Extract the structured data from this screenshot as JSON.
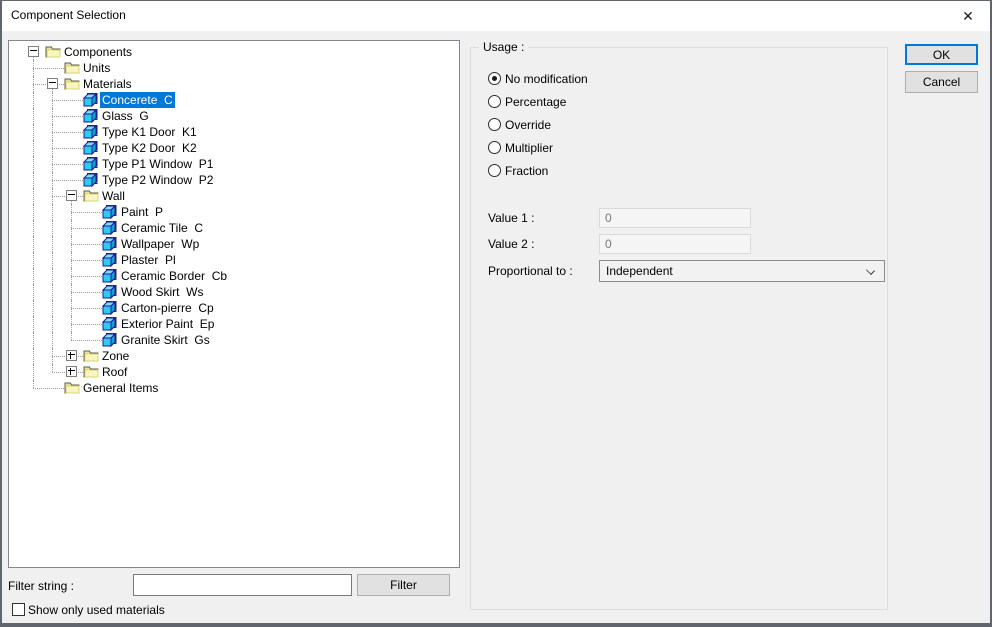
{
  "window": {
    "title": "Component Selection",
    "close_glyph": "✕"
  },
  "tree": {
    "items": [
      {
        "label": "Components",
        "depth": 0,
        "icon": "folder",
        "expander": "minus"
      },
      {
        "label": "Units",
        "depth": 1,
        "icon": "folder",
        "expander": "none"
      },
      {
        "label": "Materials",
        "depth": 1,
        "icon": "folder",
        "expander": "minus"
      },
      {
        "label": "Concerete  C",
        "depth": 2,
        "icon": "cube",
        "expander": "none",
        "selected": true
      },
      {
        "label": "Glass  G",
        "depth": 2,
        "icon": "cube",
        "expander": "none"
      },
      {
        "label": "Type K1 Door  K1",
        "depth": 2,
        "icon": "cube",
        "expander": "none"
      },
      {
        "label": "Type K2 Door  K2",
        "depth": 2,
        "icon": "cube",
        "expander": "none"
      },
      {
        "label": "Type P1 Window  P1",
        "depth": 2,
        "icon": "cube",
        "expander": "none"
      },
      {
        "label": "Type P2 Window  P2",
        "depth": 2,
        "icon": "cube",
        "expander": "none"
      },
      {
        "label": "Wall",
        "depth": 2,
        "icon": "folder",
        "expander": "minus"
      },
      {
        "label": "Paint  P",
        "depth": 3,
        "icon": "cube",
        "expander": "none"
      },
      {
        "label": "Ceramic Tile  C",
        "depth": 3,
        "icon": "cube",
        "expander": "none"
      },
      {
        "label": "Wallpaper  Wp",
        "depth": 3,
        "icon": "cube",
        "expander": "none"
      },
      {
        "label": "Plaster  Pl",
        "depth": 3,
        "icon": "cube",
        "expander": "none"
      },
      {
        "label": "Ceramic Border  Cb",
        "depth": 3,
        "icon": "cube",
        "expander": "none"
      },
      {
        "label": "Wood Skirt  Ws",
        "depth": 3,
        "icon": "cube",
        "expander": "none"
      },
      {
        "label": "Carton-pierre  Cp",
        "depth": 3,
        "icon": "cube",
        "expander": "none"
      },
      {
        "label": "Exterior Paint  Ep",
        "depth": 3,
        "icon": "cube",
        "expander": "none"
      },
      {
        "label": "Granite Skirt  Gs",
        "depth": 3,
        "icon": "cube",
        "expander": "none"
      },
      {
        "label": "Zone",
        "depth": 2,
        "icon": "folder",
        "expander": "plus"
      },
      {
        "label": "Roof",
        "depth": 2,
        "icon": "folder",
        "expander": "plus"
      },
      {
        "label": "General Items",
        "depth": 1,
        "icon": "folder",
        "expander": "none"
      }
    ]
  },
  "usage": {
    "label": "Usage :",
    "options": [
      {
        "label": "No modification",
        "selected": true
      },
      {
        "label": "Percentage",
        "selected": false
      },
      {
        "label": "Override",
        "selected": false
      },
      {
        "label": "Multiplier",
        "selected": false
      },
      {
        "label": "Fraction",
        "selected": false
      }
    ]
  },
  "fields": {
    "value1": {
      "label": "Value 1 :",
      "value": "0",
      "enabled": false
    },
    "value2": {
      "label": "Value 2 :",
      "value": "0",
      "enabled": false
    },
    "proportional": {
      "label": "Proportional to :",
      "value": "Independent"
    }
  },
  "buttons": {
    "ok": "OK",
    "cancel": "Cancel",
    "filter": "Filter"
  },
  "filter": {
    "label": "Filter string :",
    "value": ""
  },
  "show_only": {
    "label": "Show only used materials",
    "checked": false
  },
  "colors": {
    "selection": "#0078d7",
    "default_button_border": "#0078d7",
    "dialog_bg": "#f0f0f0",
    "cube_front": "#2fc9f2",
    "folder_fill": "#f9f6bd"
  }
}
